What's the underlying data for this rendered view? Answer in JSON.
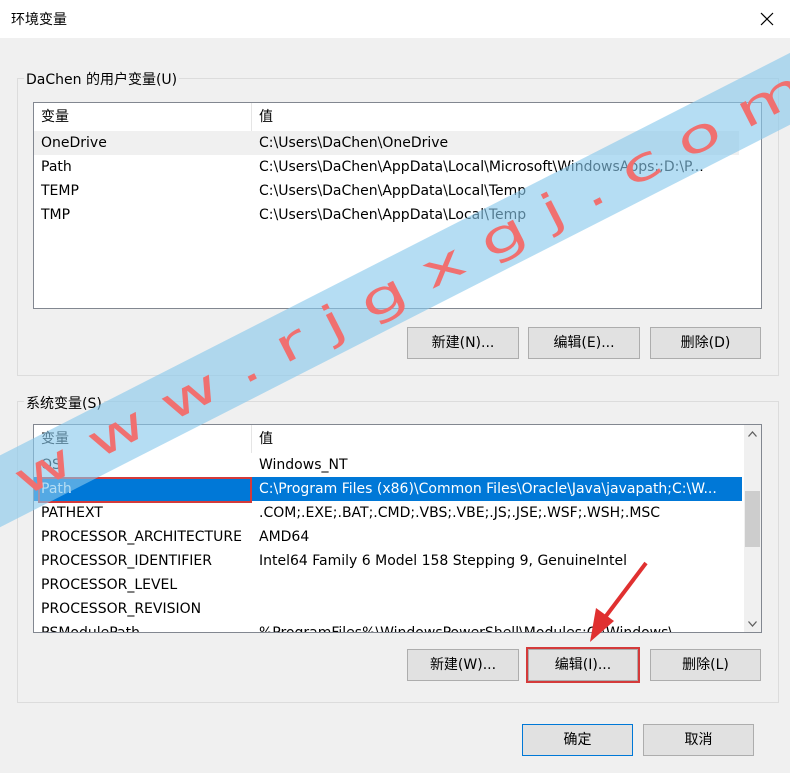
{
  "window": {
    "title": "环境变量",
    "close_icon": "close-icon"
  },
  "user_vars": {
    "group_label": "DaChen 的用户变量(U)",
    "columns": [
      "变量",
      "值"
    ],
    "rows": [
      {
        "name": "OneDrive",
        "value": "C:\\Users\\DaChen\\OneDrive"
      },
      {
        "name": "Path",
        "value": "C:\\Users\\DaChen\\AppData\\Local\\Microsoft\\WindowsApps;;D:\\P..."
      },
      {
        "name": "TEMP",
        "value": "C:\\Users\\DaChen\\AppData\\Local\\Temp"
      },
      {
        "name": "TMP",
        "value": "C:\\Users\\DaChen\\AppData\\Local\\Temp"
      }
    ],
    "buttons": {
      "new": "新建(N)...",
      "edit": "编辑(E)...",
      "delete": "删除(D)"
    }
  },
  "system_vars": {
    "group_label": "系统变量(S)",
    "columns": [
      "变量",
      "值"
    ],
    "rows": [
      {
        "name": "OS",
        "value": "Windows_NT"
      },
      {
        "name": "Path",
        "value": "C:\\Program Files (x86)\\Common Files\\Oracle\\Java\\javapath;C:\\W..."
      },
      {
        "name": "PATHEXT",
        "value": ".COM;.EXE;.BAT;.CMD;.VBS;.VBE;.JS;.JSE;.WSF;.WSH;.MSC"
      },
      {
        "name": "PROCESSOR_ARCHITECTURE",
        "value": "AMD64"
      },
      {
        "name": "PROCESSOR_IDENTIFIER",
        "value": "Intel64 Family 6 Model 158 Stepping 9, GenuineIntel"
      },
      {
        "name": "PROCESSOR_LEVEL",
        "value": ""
      },
      {
        "name": "PROCESSOR_REVISION",
        "value": ""
      },
      {
        "name": "PSModulePath",
        "value": "%ProgramFiles%\\WindowsPowerShell\\Modules;C:\\Windows\\..."
      }
    ],
    "selected_row": "Path",
    "buttons": {
      "new": "新建(W)...",
      "edit": "编辑(I)...",
      "delete": "删除(L)"
    }
  },
  "footer": {
    "ok": "确定",
    "cancel": "取消"
  },
  "watermark": {
    "text": "w w w . r j g x g j . c o m"
  },
  "colors": {
    "selection": "#0078d7",
    "highlight_box": "#d43a3a",
    "watermark_band": "#87c8eb",
    "watermark_text": "#f07070"
  }
}
